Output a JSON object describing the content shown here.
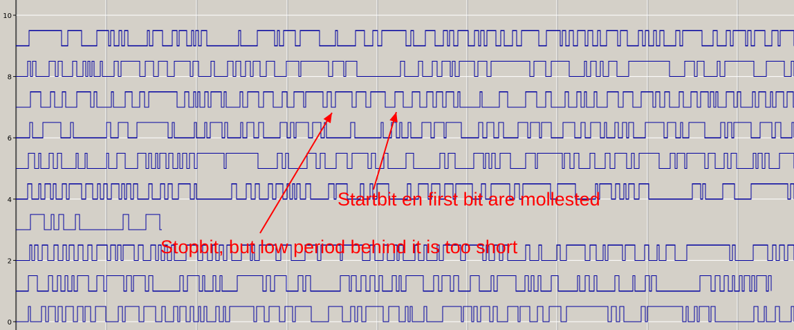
{
  "chart_data": {
    "type": "line",
    "title": "",
    "xlabel": "",
    "ylabel": "",
    "ylim": [
      0,
      10
    ],
    "yticks": [
      "0",
      "2",
      "4",
      "6",
      "8",
      "10"
    ],
    "grid": true,
    "colors": {
      "trace": "#0000a0",
      "background": "#d4d0c8",
      "grid": "#ffffff",
      "annotation": "#ff0000"
    },
    "series": [
      {
        "baseline": 0,
        "seed": 11
      },
      {
        "baseline": 1,
        "seed": 23
      },
      {
        "baseline": 2,
        "seed": 37
      },
      {
        "baseline": 3,
        "seed": 41
      },
      {
        "baseline": 4,
        "seed": 53
      },
      {
        "baseline": 5,
        "seed": 67
      },
      {
        "baseline": 6,
        "seed": 71
      },
      {
        "baseline": 7,
        "seed": 83
      },
      {
        "baseline": 8,
        "seed": 97
      },
      {
        "baseline": 9,
        "seed": 101
      }
    ],
    "annotations": [
      {
        "text": "Startbit en first bit are mollested"
      },
      {
        "text": "Stopbit, but low period behind it is too short"
      }
    ]
  }
}
